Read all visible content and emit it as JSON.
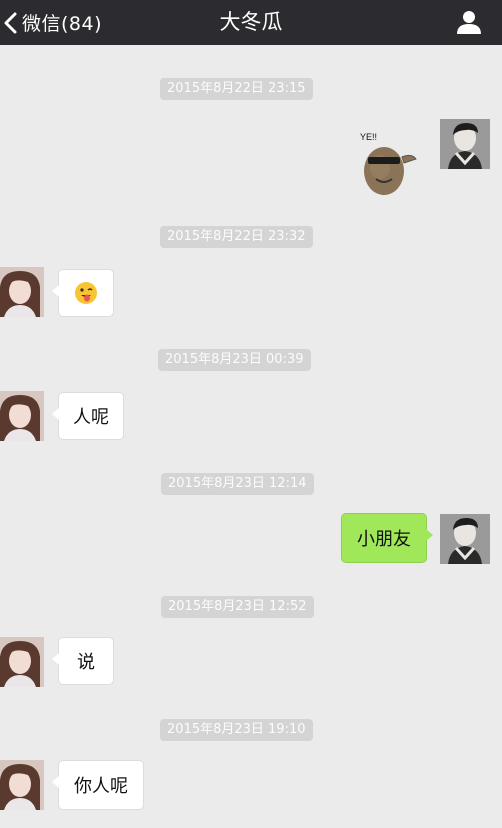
{
  "header": {
    "back_label": "微信(84)",
    "title": "大冬瓜"
  },
  "messages": [
    {
      "type": "timestamp",
      "text": "2015年8月22日 23:15"
    },
    {
      "type": "sticker",
      "side": "out",
      "sticker_caption": "YE!!",
      "icon": "potato-sticker"
    },
    {
      "type": "timestamp",
      "text": "2015年8月22日 23:32"
    },
    {
      "type": "emoji",
      "side": "in",
      "icon": "tongue-wink-emoji"
    },
    {
      "type": "timestamp",
      "text": "2015年8月23日 00:39"
    },
    {
      "type": "text",
      "side": "in",
      "text": "人呢"
    },
    {
      "type": "timestamp",
      "text": "2015年8月23日 12:14"
    },
    {
      "type": "text",
      "side": "out",
      "text": "小朋友"
    },
    {
      "type": "timestamp",
      "text": "2015年8月23日 12:52"
    },
    {
      "type": "text",
      "side": "in",
      "text": "说"
    },
    {
      "type": "timestamp",
      "text": "2015年8月23日 19:10"
    },
    {
      "type": "text",
      "side": "in",
      "text": "你人呢"
    }
  ],
  "colors": {
    "nav_bg": "#2c2c30",
    "chat_bg": "#ebebeb",
    "outgoing_bubble": "#a0e75a",
    "incoming_bubble": "#ffffff",
    "timestamp_bg": "#d4d4d4"
  }
}
